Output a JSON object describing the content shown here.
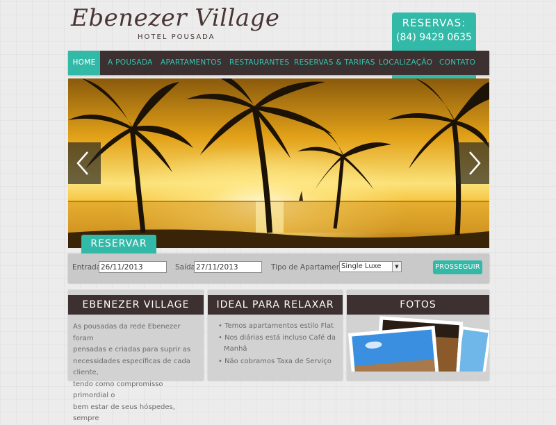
{
  "brand": {
    "name": "Ebenezer Village",
    "subtitle": "HOTEL POUSADA"
  },
  "reservas": {
    "label": "RESERVAS:",
    "phone": "(84) 9429 0635"
  },
  "nav": {
    "items": [
      {
        "label": "HOME"
      },
      {
        "label": "A POUSADA"
      },
      {
        "label": "APARTAMENTOS"
      },
      {
        "label": "RESTAURANTES"
      },
      {
        "label": "RESERVAS & TARIFAS"
      },
      {
        "label": "LOCALIZAÇÃO"
      },
      {
        "label": "CONTATO"
      }
    ]
  },
  "booking": {
    "tab_label": "RESERVAR",
    "entrada_label": "Entrada",
    "entrada_value": "26/11/2013",
    "saida_label": "Saída",
    "saida_value": "27/11/2013",
    "tipo_label": "Tipo de Apartamento",
    "tipo_value": "Single Luxe",
    "submit_label": "PROSSEGUIR"
  },
  "columns": {
    "about": {
      "title": "EBENEZER VILLAGE",
      "lines": [
        "As pousadas da rede Ebenezer foram",
        "pensadas e criadas para suprir as",
        "necessidades específicas de cada cliente,",
        "tendo como compromisso primordial o",
        "bem estar de seus hóspedes, sempre"
      ]
    },
    "relax": {
      "title": "IDEAL PARA RELAXAR",
      "bullets": [
        "Temos apartamentos estilo Flat",
        "Nos diárias está incluso Café da",
        "Manhã",
        "Não cobramos Taxa de Serviço"
      ]
    },
    "fotos": {
      "title": "FOTOS"
    }
  },
  "colors": {
    "accent": "#33b9a7",
    "dark": "#3d3030"
  }
}
